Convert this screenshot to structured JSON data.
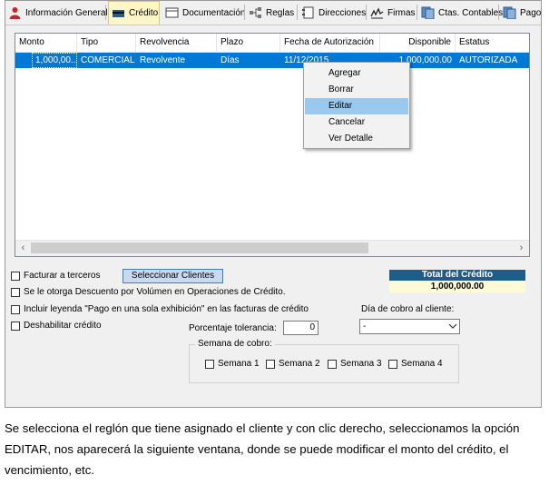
{
  "tabs": [
    {
      "label": "Información General",
      "icon": "person-icon",
      "active": false
    },
    {
      "label": "Crédito",
      "icon": "card-icon",
      "active": true
    },
    {
      "label": "Documentación",
      "icon": "document-icon",
      "active": false
    },
    {
      "label": "Reglas",
      "icon": "rules-icon",
      "active": false
    },
    {
      "label": "Direcciones",
      "icon": "address-book-icon",
      "active": false
    },
    {
      "label": "Firmas",
      "icon": "signature-icon",
      "active": false
    },
    {
      "label": "Ctas. Contables",
      "icon": "accounts-icon",
      "active": false
    },
    {
      "label": "Pagos A",
      "icon": "payments-icon",
      "active": false
    }
  ],
  "grid": {
    "columns": [
      "Monto",
      "Tipo",
      "Revolvencia",
      "Plazo",
      "Fecha de Autorización",
      "Disponible",
      "Estatus"
    ],
    "rows": [
      {
        "monto": "1,000,00...",
        "tipo": "COMERCIAL",
        "revolvencia": "Revolvente",
        "plazo": "Días",
        "fecha": "11/12/2015",
        "disponible": "1,000,000.00",
        "estatus": "AUTORIZADA"
      }
    ],
    "scroll_left": "‹",
    "scroll_right": "›"
  },
  "context_menu": {
    "items": [
      "Agregar",
      "Borrar",
      "Editar",
      "Cancelar",
      "Ver Detalle"
    ],
    "highlighted": "Editar"
  },
  "form": {
    "facturar_terceros": "Facturar a terceros",
    "seleccionar_clientes": "Seleccionar Clientes",
    "descuento_volumen": "Se le otorga Descuento por Volúmen en Operaciones de Crédito.",
    "incluir_leyenda": "Incluir leyenda \"Pago en una sola exhibición\" en las facturas de crédito",
    "deshabilitar_credito": "Deshabilitar crédito",
    "total_title": "Total del Crédito",
    "total_value": "1,000,000.00",
    "dia_cobro_label": "Día de cobro al cliente:",
    "dia_cobro_value": "-",
    "porcentaje_label": "Porcentaje tolerancia:",
    "porcentaje_value": "0",
    "semana_title": "Semana de cobro:",
    "semanas": [
      "Semana 1",
      "Semana 2",
      "Semana 3",
      "Semana 4"
    ]
  },
  "caption": "Se selecciona el reglón que tiene asignado el cliente y con clic derecho, seleccionamos la opción EDITAR, nos aparecerá la siguiente ventana, donde se puede modificar el monto del crédito, el vencimiento, etc.",
  "colors": {
    "selection": "#0078d7",
    "menu_highlight": "#99c9ef",
    "total_header": "#1f5c8a",
    "total_value_bg": "#fdfbd6"
  }
}
